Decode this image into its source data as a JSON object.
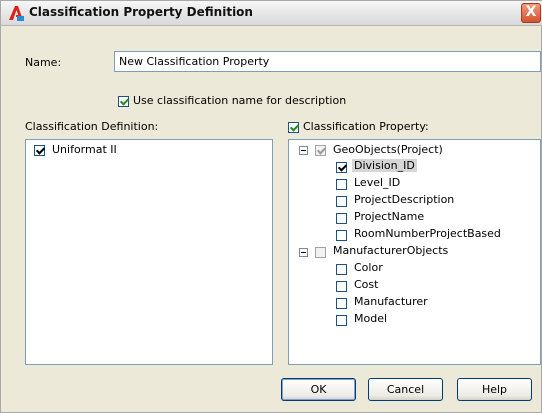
{
  "window": {
    "title": "Classification Property Definition",
    "close_glyph": "X",
    "icon": "autocad-a-icon"
  },
  "form": {
    "name_label": "Name:",
    "name_value": "New Classification Property",
    "use_desc_label": "Use classification name for description",
    "use_desc_checked": true
  },
  "definition": {
    "header": "Classification Definition:",
    "items": [
      {
        "label": "Uniformat II",
        "checked": true
      }
    ]
  },
  "property": {
    "header": "Classification Property:",
    "header_checked": true,
    "groups": [
      {
        "label": "GeoObjects(Project)",
        "checked": true,
        "children": [
          {
            "label": "Division_ID",
            "checked": true,
            "selected": true
          },
          {
            "label": "Level_ID",
            "checked": false
          },
          {
            "label": "ProjectDescription",
            "checked": false
          },
          {
            "label": "ProjectName",
            "checked": false
          },
          {
            "label": "RoomNumberProjectBased",
            "checked": false
          }
        ]
      },
      {
        "label": "ManufacturerObjects",
        "checked": false,
        "children": [
          {
            "label": "Color",
            "checked": false
          },
          {
            "label": "Cost",
            "checked": false
          },
          {
            "label": "Manufacturer",
            "checked": false
          },
          {
            "label": "Model",
            "checked": false
          }
        ]
      }
    ]
  },
  "buttons": {
    "ok": "OK",
    "cancel": "Cancel",
    "help": "Help"
  },
  "colors": {
    "dialog_bg": "#ece9d8",
    "close_button": "#d4532f",
    "checkmark": "#218b21"
  }
}
